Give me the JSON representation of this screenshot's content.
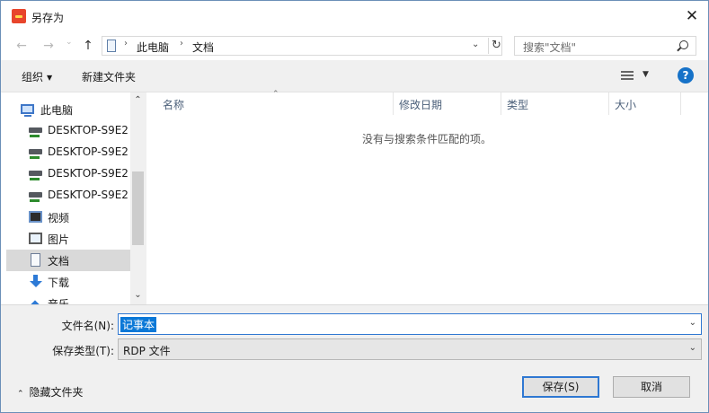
{
  "window": {
    "title": "另存为",
    "close_glyph": "✕",
    "icon": "app-icon"
  },
  "navbar": {
    "back_glyph": "←",
    "forward_glyph": "→",
    "dropdown_glyph": "⌄",
    "up_glyph": "↑",
    "breadcrumb": [
      "此电脑",
      "文档"
    ],
    "separator_glyph": "›",
    "address_dropdown_glyph": "⌄",
    "refresh_glyph": "↻",
    "search_placeholder": "搜索\"文档\""
  },
  "toolbar": {
    "organize_label": "组织",
    "organize_caret": "▼",
    "new_folder_label": "新建文件夹",
    "view_caret": "▼",
    "help_glyph": "?"
  },
  "navpane": {
    "items": [
      {
        "label": "此电脑",
        "icon": "computer-icon",
        "selected": false
      },
      {
        "label": "DESKTOP-S9E2",
        "icon": "network-drive-icon",
        "selected": false
      },
      {
        "label": "DESKTOP-S9E2",
        "icon": "network-drive-icon",
        "selected": false
      },
      {
        "label": "DESKTOP-S9E2",
        "icon": "network-drive-icon",
        "selected": false
      },
      {
        "label": "DESKTOP-S9E2",
        "icon": "network-drive-icon",
        "selected": false
      },
      {
        "label": "视频",
        "icon": "video-icon",
        "selected": false
      },
      {
        "label": "图片",
        "icon": "picture-icon",
        "selected": false
      },
      {
        "label": "文档",
        "icon": "document-icon",
        "selected": true
      },
      {
        "label": "下载",
        "icon": "download-icon",
        "selected": false
      },
      {
        "label": "音乐",
        "icon": "music-icon",
        "selected": false
      }
    ],
    "scroll_up_glyph": "⌃",
    "scroll_down_glyph": "⌄"
  },
  "filelist": {
    "sort_glyph": "⌃",
    "columns": [
      "名称",
      "修改日期",
      "类型",
      "大小"
    ],
    "empty_message": "没有与搜索条件匹配的项。"
  },
  "form": {
    "filename_label": "文件名(N):",
    "filename_value": "记事本",
    "filetype_label": "保存类型(T):",
    "filetype_value": "RDP 文件",
    "caret_glyph": "⌄"
  },
  "footer": {
    "hide_folders_caret": "⌃",
    "hide_folders_label": "隐藏文件夹",
    "save_label": "保存(S)",
    "cancel_label": "取消"
  },
  "colors": {
    "accent": "#0a78d7",
    "selection": "#d9d9d9",
    "help": "#1672c8",
    "app_icon": "#e8452c"
  }
}
